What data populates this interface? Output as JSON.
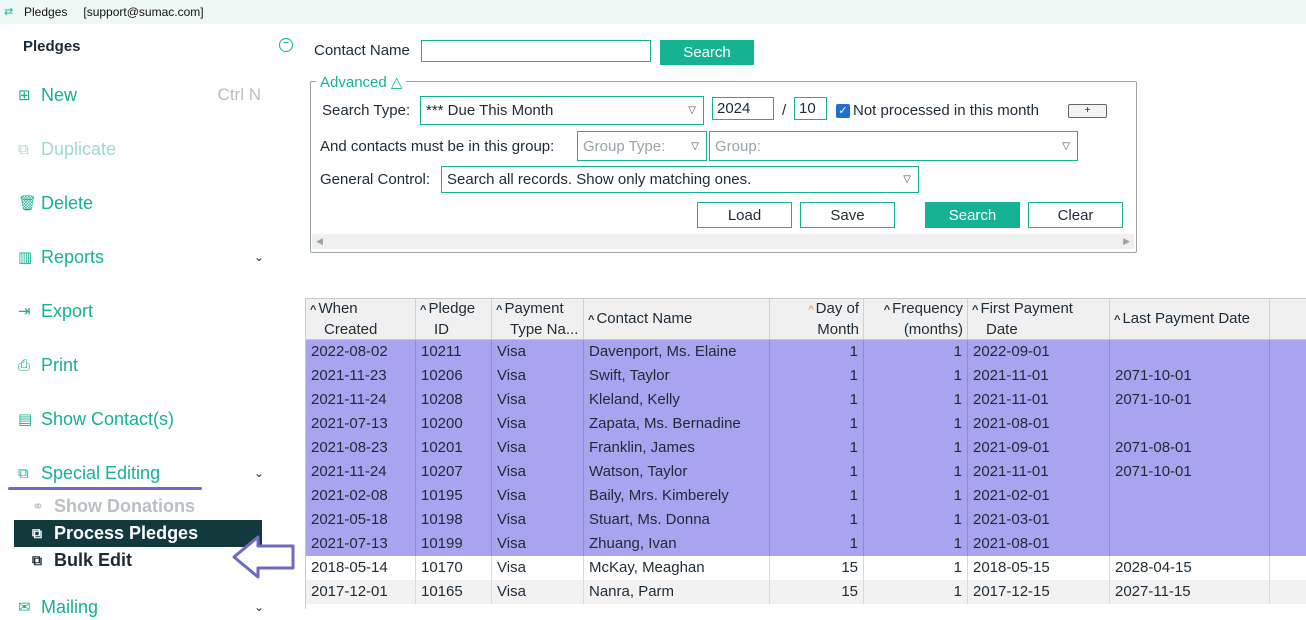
{
  "window": {
    "title": "Pledges",
    "user": "[support@sumac.com]"
  },
  "sidebar": {
    "title": "Pledges",
    "collapse_icon": "collapse-circle-icon",
    "items": [
      {
        "label": "New",
        "icon": "plus-square-icon",
        "shortcut": "Ctrl N",
        "disabled": false
      },
      {
        "label": "Duplicate",
        "icon": "duplicate-icon",
        "disabled": true
      },
      {
        "label": "Delete",
        "icon": "trash-icon",
        "disabled": false
      },
      {
        "label": "Reports",
        "icon": "bar-chart-icon",
        "expandable": true
      },
      {
        "label": "Export",
        "icon": "export-icon"
      },
      {
        "label": "Print",
        "icon": "printer-icon"
      },
      {
        "label": "Show Contact(s)",
        "icon": "contacts-icon"
      },
      {
        "label": "Special Editing",
        "icon": "special-editing-icon",
        "expandable": true
      },
      {
        "label": "Mailing",
        "icon": "mail-icon",
        "expandable": true
      }
    ],
    "subitems": [
      {
        "label": "Show Donations",
        "icon": "donations-icon",
        "disabled": true
      },
      {
        "label": "Process Pledges",
        "icon": "process-icon",
        "active": true
      },
      {
        "label": "Bulk Edit",
        "icon": "bulk-edit-icon"
      }
    ]
  },
  "search": {
    "contact_name_label": "Contact Name",
    "contact_name_value": "",
    "search_button": "Search",
    "advanced_label": "Advanced",
    "search_type_label": "Search Type:",
    "search_type_value": "*** Due This Month",
    "year": "2024",
    "slash": "/",
    "month": "10",
    "not_processed_label": "Not processed in this month",
    "not_processed_checked": true,
    "plus_button": "+",
    "group_label": "And contacts must be in this group:",
    "group_type_placeholder": "Group Type:",
    "group_placeholder": "Group:",
    "general_control_label": "General Control:",
    "general_control_value": "Search all records. Show only matching ones.",
    "load_button": "Load",
    "save_button": "Save",
    "search_button2": "Search",
    "clear_button": "Clear"
  },
  "grid": {
    "columns": [
      {
        "label1": "When",
        "label2": "Created",
        "sort": "up"
      },
      {
        "label1": "Pledge",
        "label2": "ID",
        "sort": "up"
      },
      {
        "label1": "Payment",
        "label2": "Type Na...",
        "sort": "up"
      },
      {
        "label1": "Contact Name",
        "label2": "",
        "sort": "up"
      },
      {
        "label1": "Day of",
        "label2": "Month",
        "sort": "up-active"
      },
      {
        "label1": "Frequency",
        "label2": "(months)",
        "sort": "up"
      },
      {
        "label1": "First Payment",
        "label2": "Date",
        "sort": "up"
      },
      {
        "label1": "Last Payment Date",
        "label2": "",
        "sort": "up"
      }
    ],
    "rows": [
      {
        "created": "2022-08-02",
        "id": "10211",
        "type": "Visa",
        "contact": "Davenport, Ms. Elaine",
        "day": "1",
        "freq": "1",
        "first": "2022-09-01",
        "last": "",
        "selected": true
      },
      {
        "created": "2021-11-23",
        "id": "10206",
        "type": "Visa",
        "contact": "Swift, Taylor",
        "day": "1",
        "freq": "1",
        "first": "2021-11-01",
        "last": "2071-10-01",
        "selected": true
      },
      {
        "created": "2021-11-24",
        "id": "10208",
        "type": "Visa",
        "contact": "Kleland, Kelly",
        "day": "1",
        "freq": "1",
        "first": "2021-11-01",
        "last": "2071-10-01",
        "selected": true
      },
      {
        "created": "2021-07-13",
        "id": "10200",
        "type": "Visa",
        "contact": "Zapata, Ms. Bernadine",
        "day": "1",
        "freq": "1",
        "first": "2021-08-01",
        "last": "",
        "selected": true
      },
      {
        "created": "2021-08-23",
        "id": "10201",
        "type": "Visa",
        "contact": "Franklin, James",
        "day": "1",
        "freq": "1",
        "first": "2021-09-01",
        "last": "2071-08-01",
        "selected": true
      },
      {
        "created": "2021-11-24",
        "id": "10207",
        "type": "Visa",
        "contact": "Watson, Taylor",
        "day": "1",
        "freq": "1",
        "first": "2021-11-01",
        "last": "2071-10-01",
        "selected": true
      },
      {
        "created": "2021-02-08",
        "id": "10195",
        "type": "Visa",
        "contact": "Baily, Mrs. Kimberely",
        "day": "1",
        "freq": "1",
        "first": "2021-02-01",
        "last": "",
        "selected": true
      },
      {
        "created": "2021-05-18",
        "id": "10198",
        "type": "Visa",
        "contact": "Stuart, Ms. Donna",
        "day": "1",
        "freq": "1",
        "first": "2021-03-01",
        "last": "",
        "selected": true
      },
      {
        "created": "2021-07-13",
        "id": "10199",
        "type": "Visa",
        "contact": "Zhuang, Ivan",
        "day": "1",
        "freq": "1",
        "first": "2021-08-01",
        "last": "",
        "selected": true
      },
      {
        "created": "2018-05-14",
        "id": "10170",
        "type": "Visa",
        "contact": "McKay, Meaghan",
        "day": "15",
        "freq": "1",
        "first": "2018-05-15",
        "last": "2028-04-15",
        "selected": false
      },
      {
        "created": "2017-12-01",
        "id": "10165",
        "type": "Visa",
        "contact": "Nanra, Parm",
        "day": "15",
        "freq": "1",
        "first": "2017-12-15",
        "last": "2027-11-15",
        "selected": false
      }
    ]
  },
  "colors": {
    "accent": "#16b294",
    "selection": "#a9a4f0",
    "annotation": "#6f6ac6",
    "active_bg": "#123a3d"
  }
}
